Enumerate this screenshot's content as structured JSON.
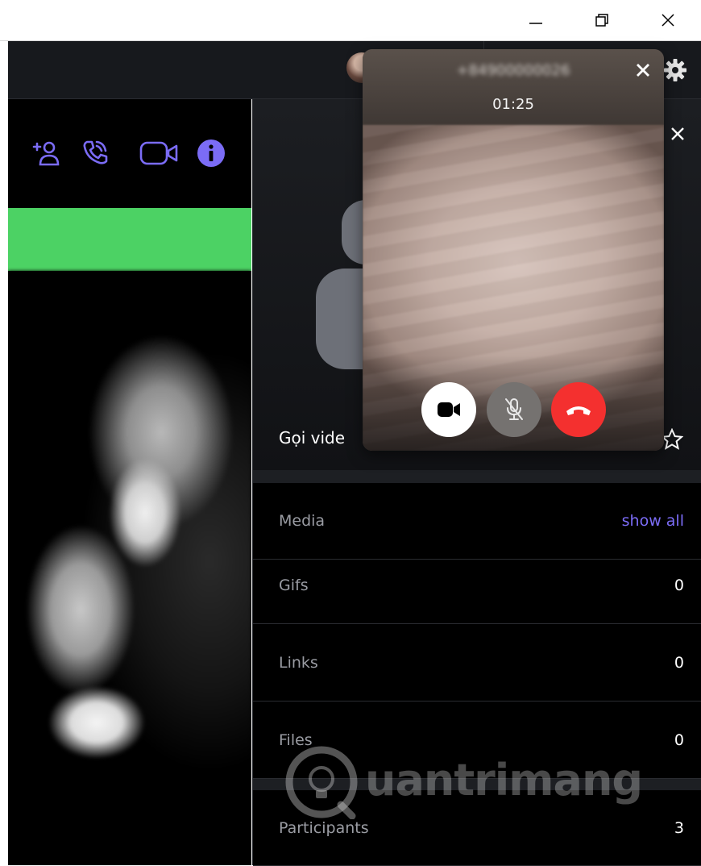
{
  "window": {
    "minimize_label": "minimize",
    "maximize_label": "restore",
    "close_label": "close"
  },
  "header": {
    "avatar_icon": "user-avatar",
    "settings_icon": "gear-icon"
  },
  "chat": {
    "actions": [
      {
        "icon": "add-participant-icon"
      },
      {
        "icon": "voice-call-icon"
      },
      {
        "icon": "video-call-icon"
      },
      {
        "icon": "info-icon"
      }
    ],
    "accent_color": "#7b6cf6",
    "bubble_color": "#4cd264"
  },
  "info_panel": {
    "group_name": "Gọi vide",
    "rows": [
      {
        "label": "Media",
        "value": "show all"
      },
      {
        "label": "Gifs",
        "value": "0"
      },
      {
        "label": "Links",
        "value": "0"
      },
      {
        "label": "Files",
        "value": "0"
      },
      {
        "label": "Participants",
        "value": "3"
      }
    ]
  },
  "call": {
    "caller_name": "+84900000026",
    "timer": "01:25",
    "end_color": "#f4302f"
  },
  "watermark": {
    "text": "uantrimang"
  }
}
